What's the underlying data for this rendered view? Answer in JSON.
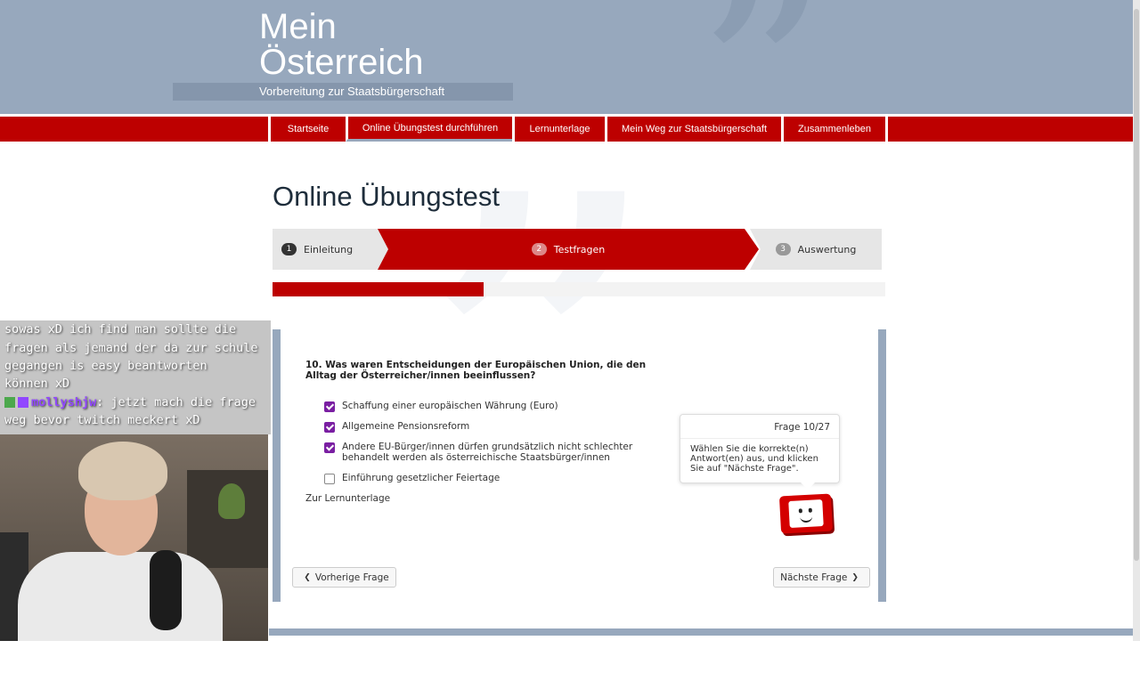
{
  "header": {
    "title_line1": "Mein",
    "title_line2": "Österreich",
    "subtitle": "Vorbereitung zur Staatsbürgerschaft"
  },
  "nav": {
    "items": [
      {
        "label": "Startseite"
      },
      {
        "label": "Online Übungstest durchführen"
      },
      {
        "label": "Lernunterlage"
      },
      {
        "label": "Mein Weg zur Staatsbürgerschaft"
      },
      {
        "label": "Zusammenleben"
      }
    ]
  },
  "page": {
    "title": "Online Übungstest"
  },
  "steps": [
    {
      "num": "1",
      "label": "Einleitung"
    },
    {
      "num": "2",
      "label": "Testfragen"
    },
    {
      "num": "3",
      "label": "Auswertung"
    }
  ],
  "progress": {
    "fraction": 0.344
  },
  "question": {
    "text": "10. Was waren Entscheidungen der Europäischen Union, die den Alltag der Österreicher/innen beeinflussen?",
    "answers": [
      {
        "label": "Schaffung einer europäischen Währung (Euro)",
        "checked": true
      },
      {
        "label": "Allgemeine Pensionsreform",
        "checked": true
      },
      {
        "label": "Andere EU-Bürger/innen dürfen grundsätzlich nicht schlechter behandelt werden als österreichische Staatsbürger/innen",
        "checked": true
      },
      {
        "label": "Einführung gesetzlicher Feiertage",
        "checked": false
      }
    ],
    "link": "Zur Lernunterlage"
  },
  "tooltip": {
    "counter": "Frage 10/27",
    "text": "Wählen Sie die korrekte(n) Antwort(en) aus, und klicken Sie auf \"Nächste Frage\"."
  },
  "buttons": {
    "prev": "Vorherige Frage",
    "next": "Nächste Frage"
  },
  "chat": {
    "line1": "sowas xD ich find man sollte die",
    "line2": "fragen als jemand der da zur schule",
    "line3": "gegangen is easy beantworten",
    "line4": "können xD",
    "user": "mollyshjw",
    "line5_rest": ": jetzt mach die frage",
    "line6": "weg bevor twitch meckert xD"
  },
  "colors": {
    "brand_red": "#bd0000",
    "header_blue": "#97a8bd",
    "check_purple": "#7a1fa2"
  }
}
